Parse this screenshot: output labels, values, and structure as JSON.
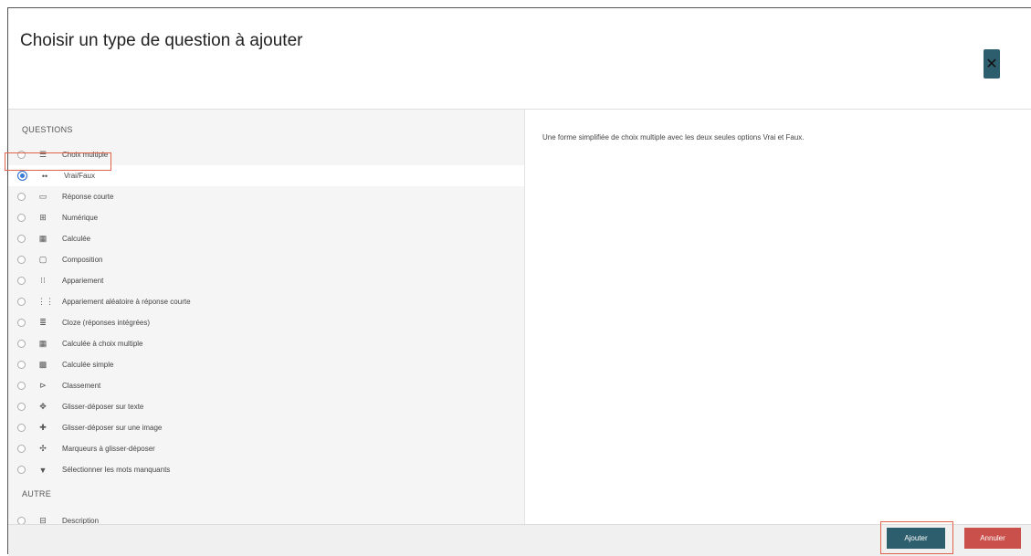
{
  "dialog": {
    "title": "Choisir un type de question à ajouter",
    "close_icon": "close-icon"
  },
  "sections": {
    "questions_label": "QUESTIONS",
    "other_label": "AUTRE"
  },
  "questions": [
    {
      "label": "Choix multiple",
      "icon": "list-icon",
      "glyph": "☰",
      "selected": false
    },
    {
      "label": "Vrai/Faux",
      "icon": "dots-icon",
      "glyph": "••",
      "selected": true
    },
    {
      "label": "Réponse courte",
      "icon": "short-answer-icon",
      "glyph": "▭",
      "selected": false
    },
    {
      "label": "Numérique",
      "icon": "numeric-icon",
      "glyph": "⊞",
      "selected": false
    },
    {
      "label": "Calculée",
      "icon": "calculated-icon",
      "glyph": "▦",
      "selected": false
    },
    {
      "label": "Composition",
      "icon": "essay-icon",
      "glyph": "▢",
      "selected": false
    },
    {
      "label": "Appariement",
      "icon": "matching-icon",
      "glyph": "⁝⁝",
      "selected": false
    },
    {
      "label": "Appariement aléatoire à réponse courte",
      "icon": "random-matching-icon",
      "glyph": "⋮⋮",
      "selected": false
    },
    {
      "label": "Cloze (réponses intégrées)",
      "icon": "cloze-icon",
      "glyph": "≣",
      "selected": false
    },
    {
      "label": "Calculée à choix multiple",
      "icon": "calc-multichoice-icon",
      "glyph": "▦",
      "selected": false
    },
    {
      "label": "Calculée simple",
      "icon": "calc-simple-icon",
      "glyph": "▩",
      "selected": false
    },
    {
      "label": "Classement",
      "icon": "ordering-icon",
      "glyph": "⊳",
      "selected": false
    },
    {
      "label": "Glisser-déposer sur texte",
      "icon": "drag-text-icon",
      "glyph": "✥",
      "selected": false
    },
    {
      "label": "Glisser-déposer sur une image",
      "icon": "drag-image-icon",
      "glyph": "✚",
      "selected": false
    },
    {
      "label": "Marqueurs à glisser-déposer",
      "icon": "drag-markers-icon",
      "glyph": "✣",
      "selected": false
    },
    {
      "label": "Sélectionner les mots manquants",
      "icon": "select-missing-icon",
      "glyph": "▼",
      "selected": false
    }
  ],
  "others": [
    {
      "label": "Description",
      "icon": "description-icon",
      "glyph": "⊟",
      "selected": false
    }
  ],
  "description_text": "Une forme simplifiée de choix multiple avec les deux seules options Vrai et Faux.",
  "footer": {
    "add_label": "Ajouter",
    "cancel_label": "Annuler"
  }
}
